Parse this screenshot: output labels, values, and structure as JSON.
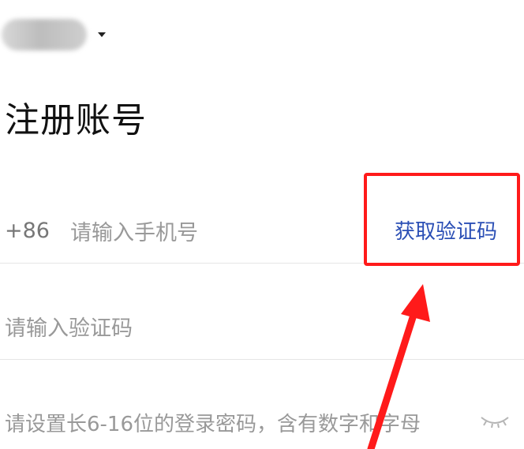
{
  "header": {
    "title": "注册账号"
  },
  "phone_row": {
    "country_code": "+86",
    "placeholder": "请输入手机号",
    "get_code_label": "获取验证码"
  },
  "code_row": {
    "placeholder": "请输入验证码"
  },
  "password_row": {
    "placeholder": "请设置长6-16位的登录密码，含有数字和字母"
  },
  "annotation": {
    "color": "#ff1a1a"
  },
  "colors": {
    "link": "#2b4fb5",
    "placeholder": "#999999"
  },
  "icons": {
    "region_caret": "caret-down-icon",
    "password_toggle": "eye-closed-icon"
  }
}
